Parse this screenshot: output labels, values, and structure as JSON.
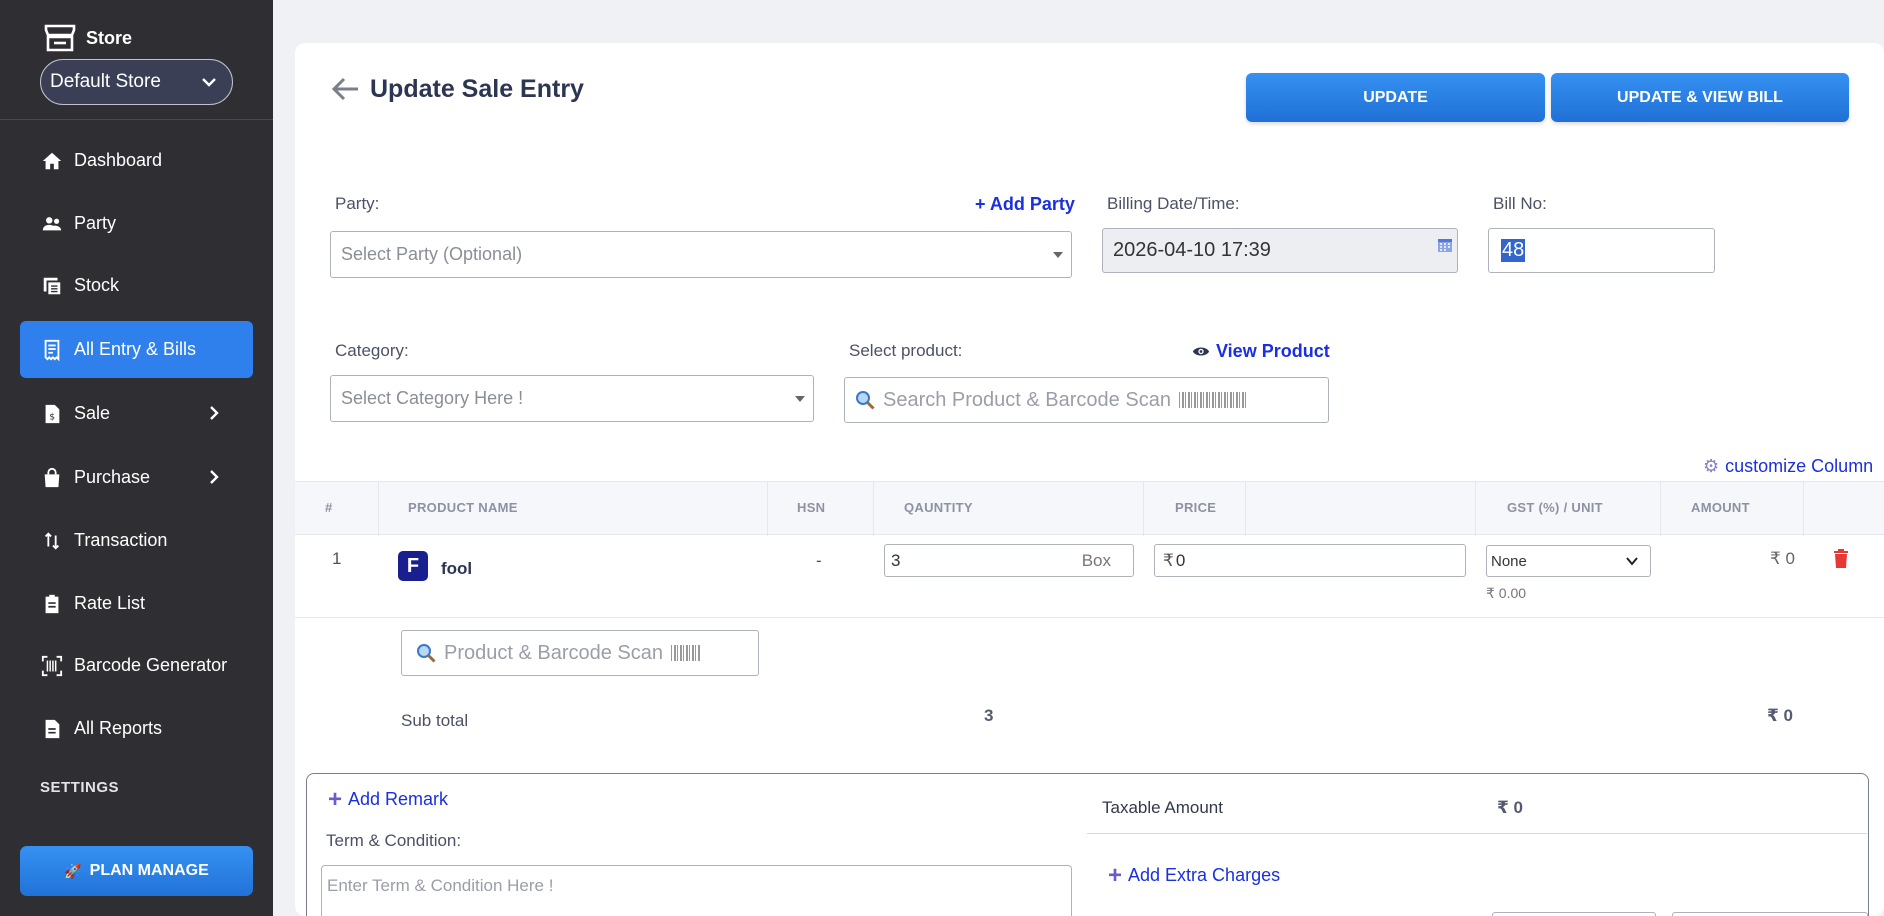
{
  "sidebar": {
    "store_label": "Store",
    "store_selected": "Default Store",
    "items": [
      {
        "label": "Dashboard",
        "icon": "home-icon"
      },
      {
        "label": "Party",
        "icon": "people-icon"
      },
      {
        "label": "Stock",
        "icon": "stock-icon"
      },
      {
        "label": "All Entry & Bills",
        "icon": "receipt-icon",
        "active": true
      },
      {
        "label": "Sale",
        "icon": "sale-doc-icon",
        "has_submenu": true
      },
      {
        "label": "Purchase",
        "icon": "shopping-bag-icon",
        "has_submenu": true
      },
      {
        "label": "Transaction",
        "icon": "transfer-icon"
      },
      {
        "label": "Rate List",
        "icon": "clipboard-icon"
      },
      {
        "label": "Barcode Generator",
        "icon": "barcode-scan-icon"
      },
      {
        "label": "All Reports",
        "icon": "report-icon"
      }
    ],
    "settings_label": "SETTINGS",
    "plan_button": "PLAN MANAGE"
  },
  "header": {
    "title": "Update Sale Entry",
    "update_button": "UPDATE",
    "update_view_button": "UPDATE & VIEW BILL"
  },
  "form": {
    "party_label": "Party:",
    "add_party_link": "+ Add Party",
    "party_placeholder": "Select Party (Optional)",
    "billing_label": "Billing Date/Time:",
    "billing_value": "2026-04-10 17:39",
    "bill_no_label": "Bill No:",
    "bill_no_value": "48",
    "category_label": "Category:",
    "category_placeholder": "Select Category Here !",
    "product_label": "Select product:",
    "view_product_link": "View Product",
    "product_search_placeholder": "Search Product & Barcode Scan",
    "customize_link": "customize Column"
  },
  "table": {
    "headers": [
      "#",
      "PRODUCT NAME",
      "HSN",
      "QAUNTITY",
      "PRICE",
      "GST (%) / UNIT",
      "AMOUNT"
    ],
    "rows": [
      {
        "index": "1",
        "badge": "F",
        "name": "fool",
        "hsn": "-",
        "quantity": "3",
        "unit": "Box",
        "price": "0",
        "currency": "₹",
        "gst": "None",
        "gst_amount": "₹ 0.00",
        "amount": "₹ 0"
      }
    ],
    "row_search_placeholder": "Product & Barcode Scan",
    "subtotal_label": "Sub total",
    "subtotal_qty": "3",
    "subtotal_amount": "₹ 0"
  },
  "footer": {
    "add_remark": "Add Remark",
    "terms_label": "Term & Condition:",
    "terms_placeholder": "Enter Term & Condition Here !",
    "taxable_label": "Taxable Amount",
    "taxable_value": "₹ 0",
    "add_charges": "Add Extra Charges"
  },
  "colors": {
    "accent": "#2f80ed",
    "sidebar": "#2f2f33",
    "link": "#1a2fe0",
    "delete": "#e53935"
  }
}
